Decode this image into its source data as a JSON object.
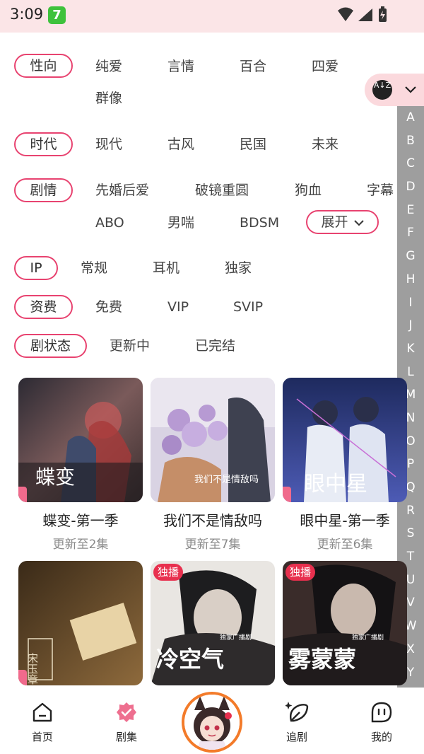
{
  "status_bar": {
    "time": "3:09",
    "app_badge": "7"
  },
  "filters": {
    "gender": {
      "label": "性向",
      "options": [
        "纯爱",
        "言情",
        "百合",
        "四爱",
        "群像"
      ]
    },
    "era": {
      "label": "时代",
      "options": [
        "现代",
        "古风",
        "民国",
        "未来"
      ]
    },
    "plot": {
      "label": "剧情",
      "options": [
        "先婚后爱",
        "破镜重圆",
        "狗血",
        "字幕",
        "ABO",
        "男喘",
        "BDSM"
      ],
      "more": "展开"
    },
    "ip": {
      "label": "IP",
      "options": [
        "常规",
        "耳机",
        "独家"
      ]
    },
    "fee": {
      "label": "资费",
      "options": [
        "免费",
        "VIP",
        "SVIP"
      ]
    },
    "status": {
      "label": "剧状态",
      "options": [
        "更新中",
        "已完结"
      ]
    }
  },
  "sort": {
    "icon": "az-sort-icon",
    "az_text": "A↓Z"
  },
  "alphabet": [
    "A",
    "B",
    "C",
    "D",
    "E",
    "F",
    "G",
    "H",
    "I",
    "J",
    "K",
    "L",
    "M",
    "N",
    "O",
    "P",
    "Q",
    "R",
    "S",
    "T",
    "U",
    "V",
    "W",
    "X",
    "Y"
  ],
  "cards": [
    {
      "title": "蝶变-第一季",
      "sub": "更新至2集"
    },
    {
      "title": "我们不是情敌吗",
      "sub": "更新至7集"
    },
    {
      "title": "眼中星-第一季",
      "sub": "更新至6集"
    },
    {
      "title": "",
      "sub": "",
      "cover_text": "宋玉章"
    },
    {
      "title": "",
      "sub": "",
      "tag": "独播",
      "cover_text": "冷空气",
      "cover_small": "独家广播剧"
    },
    {
      "title": "",
      "sub": "",
      "tag": "独播",
      "cover_text": "雾蒙蒙",
      "cover_small": "独家广播剧"
    }
  ],
  "tabs": [
    {
      "label": "首页",
      "icon": "home-icon"
    },
    {
      "label": "剧集",
      "icon": "drama-badge-icon"
    },
    {
      "label": "",
      "icon": "fox-avatar-icon"
    },
    {
      "label": "追剧",
      "icon": "follow-leaf-icon"
    },
    {
      "label": "我的",
      "icon": "profile-icon"
    }
  ],
  "colors": {
    "accent": "#e84370",
    "status_bg": "#fbe5e7",
    "index_bg": "#9e9e9e",
    "avatar_ring": "#f37b2a"
  }
}
